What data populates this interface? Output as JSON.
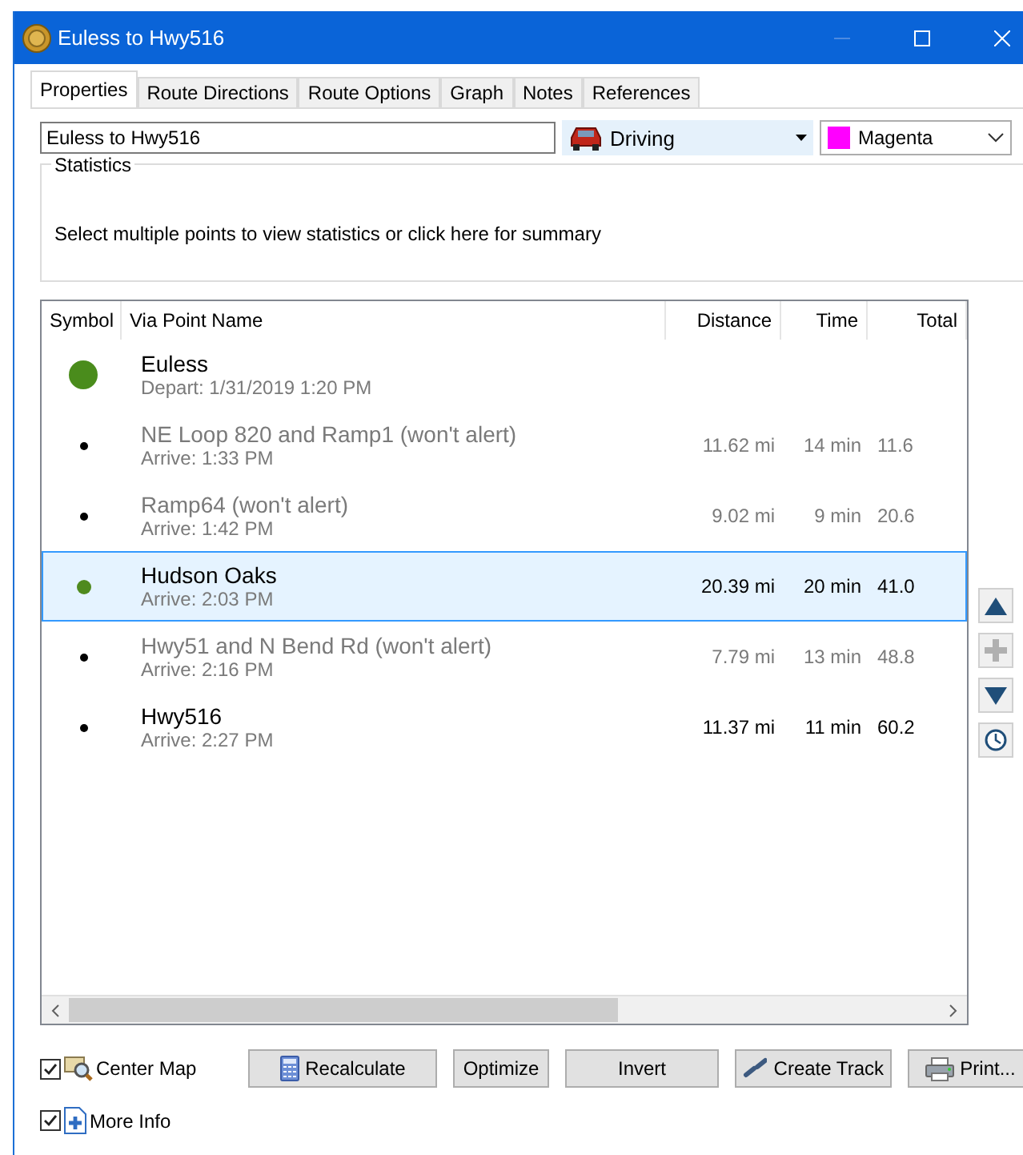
{
  "window": {
    "title": "Euless to Hwy516"
  },
  "tabs": [
    {
      "label": "Properties",
      "selected": true
    },
    {
      "label": "Route Directions",
      "selected": false
    },
    {
      "label": "Route Options",
      "selected": false
    },
    {
      "label": "Graph",
      "selected": false
    },
    {
      "label": "Notes",
      "selected": false
    },
    {
      "label": "References",
      "selected": false
    }
  ],
  "name_field": {
    "value": "Euless to Hwy516"
  },
  "mode_dropdown": {
    "value": "Driving"
  },
  "color_dropdown": {
    "value": "Magenta",
    "color": "#ff00ff"
  },
  "statistics": {
    "title": "Statistics",
    "message": "Select multiple points to view statistics or click here for summary"
  },
  "table": {
    "columns": [
      "Symbol",
      "Via Point Name",
      "Distance",
      "Time",
      "Total"
    ],
    "rows": [
      {
        "kind": "start",
        "name": "Euless",
        "detail": "Depart: 1/31/2019 1:20 PM",
        "dimmed": false,
        "selected": false
      },
      {
        "kind": "point",
        "name": "NE Loop 820 and Ramp1 (won't alert)",
        "detail": "Arrive: 1:33 PM",
        "distance": "11.62 mi",
        "time": "14 min",
        "total": "11.6",
        "dimmed": true,
        "selected": false
      },
      {
        "kind": "point",
        "name": "Ramp64 (won't alert)",
        "detail": "Arrive: 1:42 PM",
        "distance": "9.02 mi",
        "time": "9 min",
        "total": "20.6",
        "dimmed": true,
        "selected": false
      },
      {
        "kind": "stop",
        "name": "Hudson Oaks",
        "detail": "Arrive: 2:03 PM",
        "distance": "20.39 mi",
        "time": "20 min",
        "total": "41.0",
        "dimmed": false,
        "selected": true
      },
      {
        "kind": "point",
        "name": "Hwy51 and N Bend Rd (won't alert)",
        "detail": "Arrive: 2:16 PM",
        "distance": "7.79 mi",
        "time": "13 min",
        "total": "48.8",
        "dimmed": true,
        "selected": false
      },
      {
        "kind": "point",
        "name": "Hwy516",
        "detail": "Arrive: 2:27 PM",
        "distance": "11.37 mi",
        "time": "11 min",
        "total": "60.2",
        "dimmed": false,
        "selected": false
      }
    ]
  },
  "side_buttons": [
    {
      "kind": "up",
      "disabled": false
    },
    {
      "kind": "add",
      "disabled": true
    },
    {
      "kind": "down",
      "disabled": false
    },
    {
      "kind": "clock",
      "disabled": false
    }
  ],
  "checkboxes": [
    {
      "label": "Center Map",
      "checked": true,
      "kind": "map"
    },
    {
      "label": "More Info",
      "checked": true,
      "kind": "info"
    }
  ],
  "buttons": [
    {
      "label": "Recalculate",
      "kind": "calc"
    },
    {
      "label": "Optimize",
      "kind": "plain"
    },
    {
      "label": "Invert",
      "kind": "plain"
    },
    {
      "label": "Create Track",
      "kind": "track"
    },
    {
      "label": "Print...",
      "kind": "print"
    }
  ]
}
